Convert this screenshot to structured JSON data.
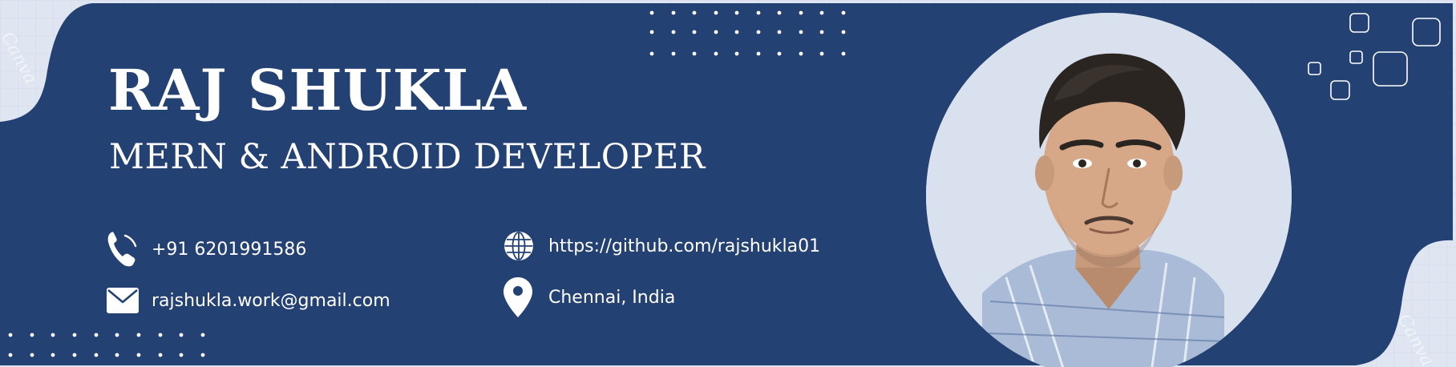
{
  "profile": {
    "name": "RAJ SHUKLA",
    "role": "MERN & ANDROID DEVELOPER"
  },
  "contacts": {
    "phone": {
      "icon": "phone-icon",
      "value": "+91 6201991586"
    },
    "email": {
      "icon": "envelope-icon",
      "value": "rajshukla.work@gmail.com"
    },
    "website": {
      "icon": "globe-icon",
      "value": "https://github.com/rajshukla01"
    },
    "location": {
      "icon": "map-pin-icon",
      "value": "Chennai, India"
    }
  },
  "colors": {
    "primary_navy": "#244173",
    "light_background": "#dfe6f1",
    "text": "#ffffff",
    "portrait_background": "#d9e1ee"
  },
  "watermarks": {
    "left": "Canva",
    "right": "Canva"
  }
}
